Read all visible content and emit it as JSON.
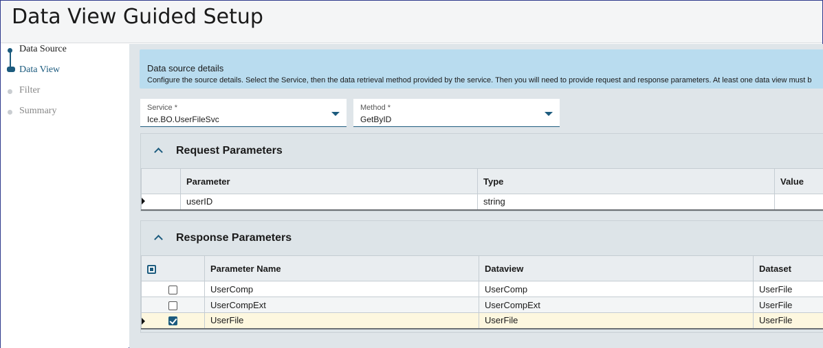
{
  "title": "Data View Guided Setup",
  "steps": [
    {
      "label": "Data Source"
    },
    {
      "label": "Data View"
    },
    {
      "label": "Filter"
    },
    {
      "label": "Summary"
    }
  ],
  "info": {
    "title": "Data source details",
    "description": "Configure the source details. Select the Service, then the data retrieval method provided by the service. Then you will need to provide request and response parameters. At least one data view must b"
  },
  "service": {
    "label": "Service *",
    "value": "Ice.BO.UserFileSvc"
  },
  "method": {
    "label": "Method *",
    "value": "GetByID"
  },
  "request": {
    "title": "Request Parameters",
    "columns": [
      "Parameter",
      "Type",
      "Value"
    ],
    "rows": [
      {
        "parameter": "userID",
        "type": "string",
        "value": ""
      }
    ]
  },
  "response": {
    "title": "Response Parameters",
    "columns": [
      "Parameter Name",
      "Dataview",
      "Dataset"
    ],
    "rows": [
      {
        "name": "UserComp",
        "dataview": "UserComp",
        "dataset": "UserFile",
        "checked": false
      },
      {
        "name": "UserCompExt",
        "dataview": "UserCompExt",
        "dataset": "UserFile",
        "checked": false
      },
      {
        "name": "UserFile",
        "dataview": "UserFile",
        "dataset": "UserFile",
        "checked": true
      }
    ]
  }
}
